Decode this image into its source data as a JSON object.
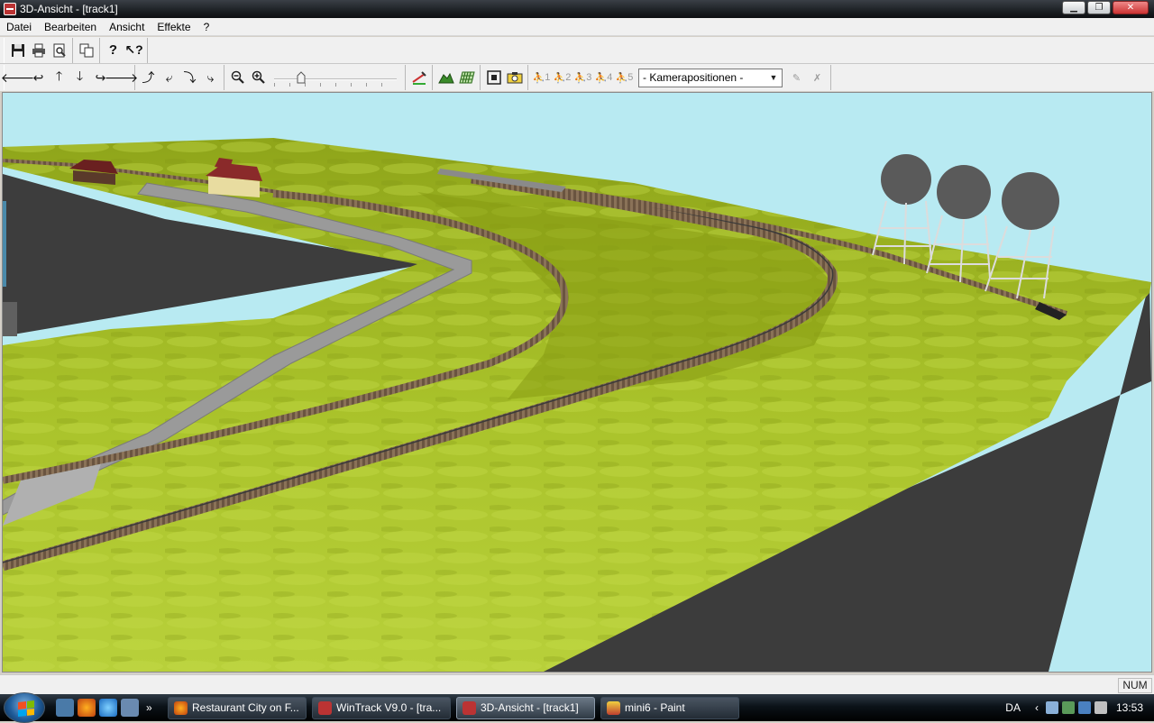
{
  "window": {
    "title": "3D-Ansicht - [track1]"
  },
  "menu": {
    "items": [
      "Datei",
      "Bearbeiten",
      "Ansicht",
      "Effekte",
      "?"
    ]
  },
  "toolbar2": {
    "camera_select_value": "- Kamerapositionen -",
    "camera_slots": [
      "1",
      "2",
      "3",
      "4",
      "5"
    ]
  },
  "status": {
    "num": "NUM"
  },
  "taskbar": {
    "tasks": [
      {
        "label": "Restaurant City on F..."
      },
      {
        "label": "WinTrack  V9.0 - [tra..."
      },
      {
        "label": "3D-Ansicht - [track1]"
      },
      {
        "label": "mini6 - Paint"
      }
    ],
    "language": "DA",
    "clock": "13:53"
  },
  "icons": {
    "save": "floppy-icon",
    "print": "printer-icon",
    "preview": "print-preview-icon",
    "copy": "copy-icon",
    "help": "help-icon",
    "context_help": "context-help-icon",
    "nav": [
      "arrow-left-icon",
      "turn-left-icon",
      "arrow-up-icon",
      "arrow-down-icon",
      "turn-right-icon",
      "arrow-right-icon"
    ],
    "tilt": [
      "tilt-up-icon",
      "tilt-left-icon",
      "tilt-down-icon",
      "tilt-right-icon"
    ],
    "zoom": [
      "zoom-out-icon",
      "zoom-in-icon"
    ]
  },
  "colors": {
    "sky": "#b8eaf2",
    "grass": "#a3bd24",
    "table_side": "#3c3c3c",
    "road": "#9c9c9c"
  }
}
